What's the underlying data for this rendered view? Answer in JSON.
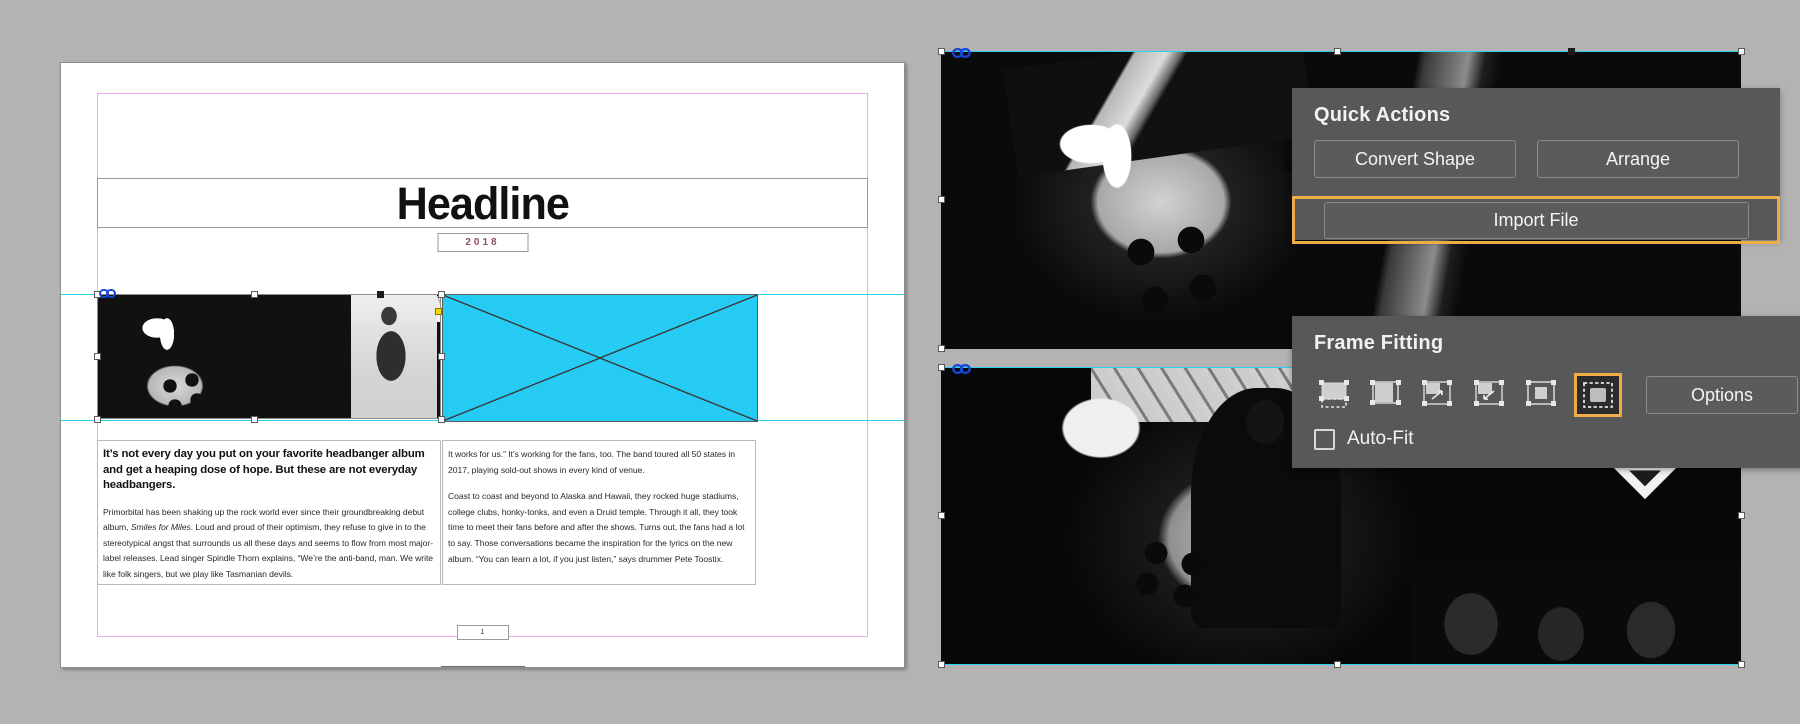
{
  "app": {
    "canvas_background": "#b3b3b3",
    "selection_color": "#2ad2f2",
    "highlight_color": "#f0ab49",
    "panel_color": "#585858"
  },
  "document": {
    "headline": "Headline",
    "year": "2018",
    "page_number": "1",
    "graphic_placeholder_color": "#25cbf3",
    "columns": [
      {
        "name": "left-column",
        "lede": "It’s not every day you put on your favorite headbanger album and get a heaping dose of hope. But these are not everyday headbangers.",
        "body": "Primorbital has been shaking up the rock world ever since their groundbreaking debut album, ",
        "body_italic": "Smiles for Miles",
        "body_rest": ". Loud and proud of their optimism, they refuse to give in to the stereotypical angst that surrounds us all these days and seems to flow from most major-label releases. Lead singer Spindle Thorn explains, “We’re the anti-band, man. We write like folk singers, but we play like Tasmanian devils."
      },
      {
        "name": "right-column",
        "para1": "It works for us.” It’s working for the fans, too. The band toured all 50 states in 2017, playing sold-out shows in every kind of venue.",
        "para2": "Coast to coast and beyond to Alaska and Hawaii, they rocked huge stadiums, college clubs, honky-tonks, and even a Druid temple. Through it all, they took time to meet their fans before and after the shows. Turns out, the fans had a lot to say. Those conversations became the inspiration for the lyrics on the new album. “You can learn a lot, if you just listen,” says drummer Pete Toostix."
      }
    ]
  },
  "quick_actions": {
    "title": "Quick Actions",
    "convert_shape_label": "Convert Shape",
    "arrange_label": "Arrange",
    "import_file_label": "Import File",
    "import_file_highlighted": true
  },
  "frame_fitting": {
    "title": "Frame Fitting",
    "options_label": "Options",
    "autofit_label": "Auto-Fit",
    "autofit_checked": false,
    "selected_index": 5,
    "icons": [
      {
        "name": "fit-content-to-frame-icon",
        "label": "Fit Content to Frame"
      },
      {
        "name": "fit-frame-to-content-icon",
        "label": "Fit Frame to Content"
      },
      {
        "name": "fit-content-proportionally-icon",
        "label": "Fit Content Proportionally"
      },
      {
        "name": "fill-frame-proportionally-icon",
        "label": "Fill Frame Proportionally"
      },
      {
        "name": "center-content-icon",
        "label": "Center Content"
      },
      {
        "name": "content-aware-fit-icon",
        "label": "Content-Aware Fit"
      }
    ]
  }
}
